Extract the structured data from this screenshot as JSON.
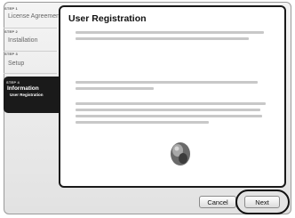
{
  "steps": [
    {
      "num": "STEP 1",
      "label": "License Agreement"
    },
    {
      "num": "STEP 2",
      "label": "Installation"
    },
    {
      "num": "STEP 3",
      "label": "Setup"
    },
    {
      "num": "STEP 4",
      "label": "Information",
      "sub": "User Registration",
      "active": true
    }
  ],
  "panel": {
    "title": "User Registration"
  },
  "buttons": {
    "cancel": "Cancel",
    "next": "Next"
  },
  "colors": {
    "active_step_bg": "#1a1a1a",
    "panel_border": "#1a1a1a"
  }
}
